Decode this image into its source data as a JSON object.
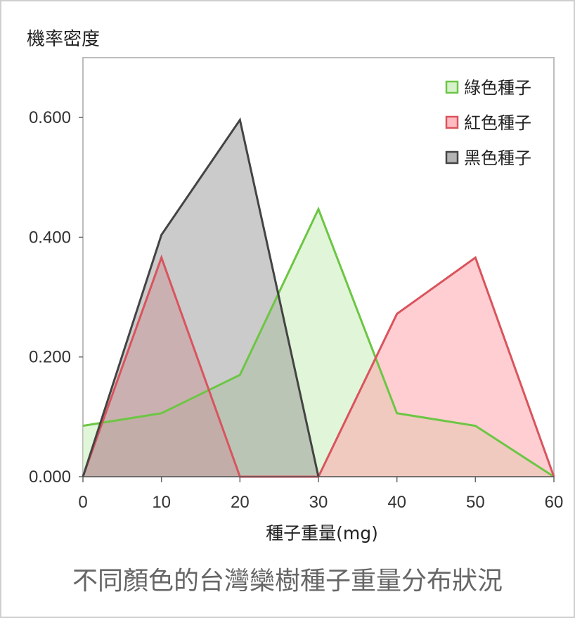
{
  "caption": "不同顏色的台灣欒樹種子重量分布狀況",
  "chart_data": {
    "type": "area",
    "title": "",
    "ylabel": "機率密度",
    "xlabel": "種子重量(mg)",
    "x": [
      0,
      10,
      20,
      30,
      40,
      50,
      60
    ],
    "xlim": [
      0,
      60
    ],
    "ylim": [
      0,
      0.7
    ],
    "x_ticks": [
      "0",
      "10",
      "20",
      "30",
      "40",
      "50",
      "60"
    ],
    "y_ticks": [
      {
        "value": 0.0,
        "label": "0.000"
      },
      {
        "value": 0.2,
        "label": "0.200"
      },
      {
        "value": 0.4,
        "label": "0.400"
      },
      {
        "value": 0.6,
        "label": "0.600"
      }
    ],
    "grid": false,
    "legend_position": "top-right",
    "series": [
      {
        "name": "綠色種子",
        "key": "green",
        "stroke": "#6cc644",
        "fill": "#cdeebf",
        "fill_opacity": 0.6,
        "values": [
          0.085,
          0.106,
          0.17,
          0.447,
          0.106,
          0.085,
          0.0
        ]
      },
      {
        "name": "紅色種子",
        "key": "red",
        "stroke": "#d9545d",
        "fill": "#ff9ea6",
        "fill_opacity": 0.5,
        "values": [
          0.0,
          0.366,
          0.0,
          0.0,
          0.272,
          0.366,
          0.0
        ]
      },
      {
        "name": "黑色種子",
        "key": "black",
        "stroke": "#444444",
        "fill": "#8c8c8c",
        "fill_opacity": 0.45,
        "values": [
          0.0,
          0.404,
          0.596,
          0.0,
          null,
          null,
          null
        ]
      }
    ]
  }
}
